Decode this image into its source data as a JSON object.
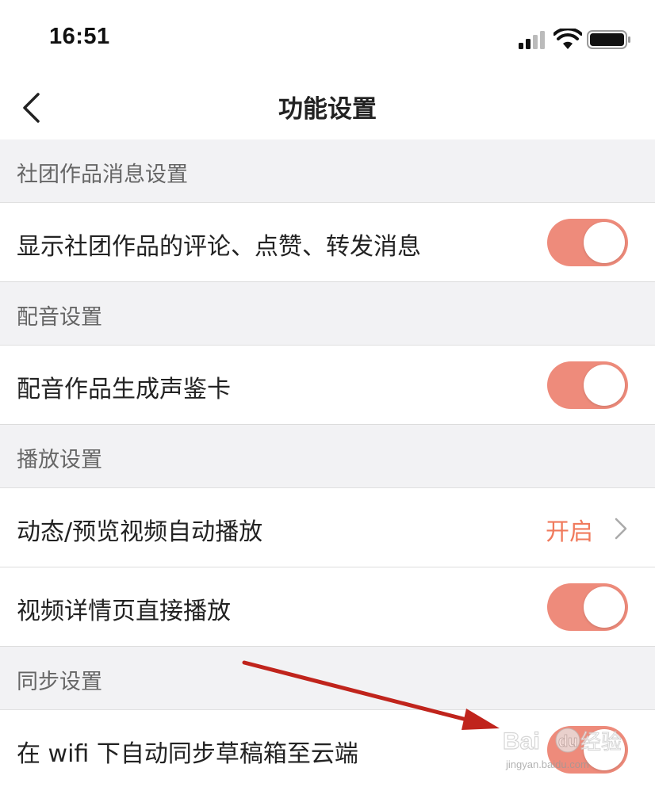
{
  "status_bar": {
    "time": "16:51",
    "icons": [
      "signal-icon",
      "wifi-icon",
      "battery-icon"
    ]
  },
  "nav": {
    "title": "功能设置",
    "back_icon": "chevron-left-icon"
  },
  "sections": [
    {
      "header": "社团作品消息设置",
      "rows": [
        {
          "label": "显示社团作品的评论、点赞、转发消息",
          "type": "toggle",
          "on": true
        }
      ]
    },
    {
      "header": "配音设置",
      "rows": [
        {
          "label": "配音作品生成声鉴卡",
          "type": "toggle",
          "on": true
        }
      ]
    },
    {
      "header": "播放设置",
      "rows": [
        {
          "label": "动态/预览视频自动播放",
          "type": "link",
          "value": "开启"
        },
        {
          "label": "视频详情页直接播放",
          "type": "toggle",
          "on": true
        }
      ]
    },
    {
      "header": "同步设置",
      "rows": [
        {
          "label": "在 wifi 下自动同步草稿箱至云端",
          "type": "toggle",
          "on": true
        }
      ]
    }
  ],
  "watermark": {
    "brand": "Baidu经验",
    "url": "jingyan.baidu.com"
  },
  "colors": {
    "accent": "#ee8b7b",
    "value_text": "#f07a5c",
    "section_bg": "#f2f2f4",
    "arrow": "#c0241c"
  }
}
